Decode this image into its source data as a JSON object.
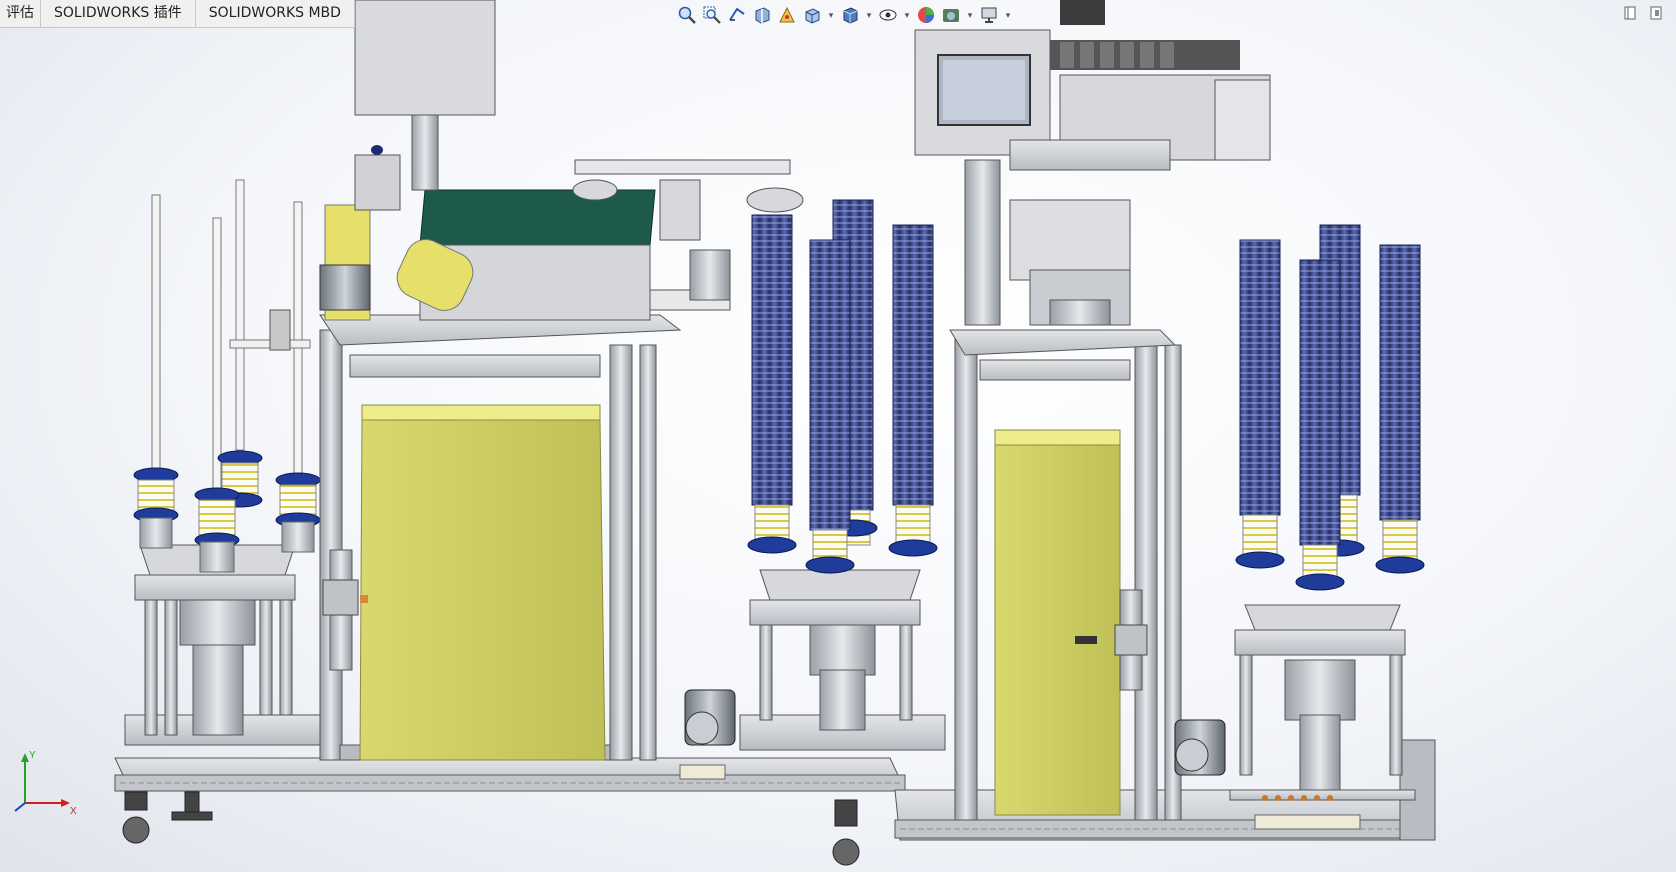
{
  "window": {
    "tabs": [
      {
        "label": "评估"
      },
      {
        "label": "SOLIDWORKS 插件"
      },
      {
        "label": "SOLIDWORKS MBD"
      }
    ]
  },
  "heads_up_toolbar": {
    "icons": [
      "zoom-to-fit-icon",
      "zoom-to-area-icon",
      "previous-view-icon",
      "section-view-icon",
      "dynamic-annotation-icon",
      "view-orientation-icon",
      "display-style-icon",
      "hide-show-icon",
      "edit-appearance-icon",
      "apply-scene-icon",
      "view-settings-icon"
    ]
  },
  "triad": {
    "x_label": "X",
    "y_label": "Y"
  },
  "colors": {
    "frame": "#c8ccd0",
    "yellow_box": "#e8e87a",
    "spring_blue": "#2b3a8f",
    "conveyor_green": "#1f5a4a",
    "panel_gray": "#d7d9dc"
  }
}
